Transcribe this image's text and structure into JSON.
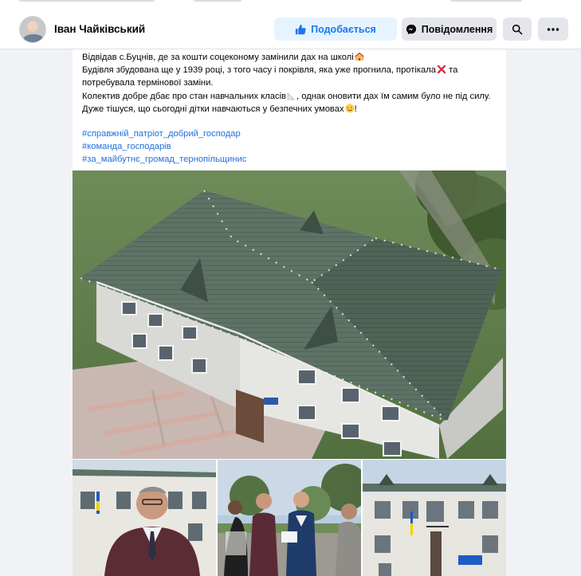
{
  "header": {
    "page_name": "Іван Чайківський",
    "like_label": "Подобається",
    "message_label": "Повідомлення",
    "icons": {
      "like": "thumbs-up-icon",
      "message": "messenger-icon",
      "search": "search-icon",
      "more": "more-icon"
    }
  },
  "post": {
    "lines": [
      "Відвідав с.Буцнів, де за кошти соцеконому замінили дах на школі",
      "Будівля збудована ще у 1939 році, з того часу і покрівля, яка уже  прогнила, протікала",
      "та потребувала термінової заміни.",
      "Колектив добре дбає про стан навчальних класів",
      ", однак оновити дах їм самим було не під силу.",
      "Дуже тішуся, що сьогодні дітки навчаються у безпечних умовах",
      "!"
    ],
    "hashtags": [
      "#справжній_патріот_добрий_господар",
      "#команда_господарів",
      "#за_майбутнє_громад_тернопільщинис"
    ],
    "emoji_icons": [
      "school-emoji",
      "cross-mark-emoji",
      "ruler-emoji",
      "heart-eyes-emoji"
    ]
  },
  "colors": {
    "accent": "#1877f2",
    "hashtag": "#216fdb",
    "roof": "#5b6f62",
    "background": "#f0f2f5"
  }
}
